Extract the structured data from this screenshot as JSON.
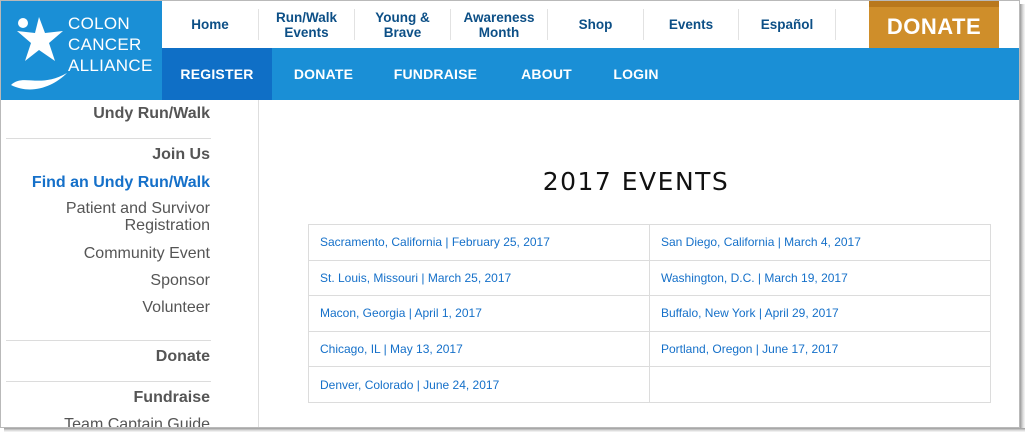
{
  "brand": {
    "logo_lines": [
      "COLON",
      "CANCER",
      "ALLIANCE"
    ]
  },
  "top_nav": {
    "home": "Home",
    "run_walk_events": [
      "Run/Walk",
      "Events"
    ],
    "young_brave": [
      "Young &",
      "Brave"
    ],
    "awareness_month": [
      "Awareness",
      "Month"
    ],
    "shop": "Shop",
    "events": "Events",
    "espanol": "Español",
    "donate_ribbon": "DONATE"
  },
  "blue_nav": {
    "register": "REGISTER",
    "donate": "DONATE",
    "fundraise": "FUNDRAISE",
    "about": "ABOUT",
    "login": "LOGIN"
  },
  "sidebar": {
    "undy_run_walk": "Undy Run/Walk",
    "join_us": "Join Us",
    "find_event": "Find an Undy Run/Walk",
    "patient_survivor": [
      "Patient and Survivor",
      "Registration"
    ],
    "community_event": "Community Event",
    "sponsor": "Sponsor",
    "volunteer": "Volunteer",
    "donate": "Donate",
    "fundraise": "Fundraise",
    "team_captain_guide": "Team Captain Guide"
  },
  "main": {
    "title": "2017 EVENTS",
    "events": [
      [
        "Sacramento, California | February 25, 2017",
        "San Diego, California | March 4, 2017"
      ],
      [
        "St. Louis, Missouri | March 25, 2017",
        "Washington, D.C. | March 19, 2017"
      ],
      [
        "Macon, Georgia | April 1, 2017",
        "Buffalo, New York | April 29, 2017"
      ],
      [
        "Chicago, IL | May 13, 2017",
        "Portland, Oregon | June 17, 2017"
      ],
      [
        "Denver, Colorado | June 24, 2017",
        ""
      ]
    ]
  },
  "colors": {
    "brand_blue": "#1a8fd6",
    "register_blue": "#0f6fc6",
    "nav_text": "#0c4f86",
    "link_blue": "#1570c9",
    "donate_gold": "#cf8e2a"
  }
}
